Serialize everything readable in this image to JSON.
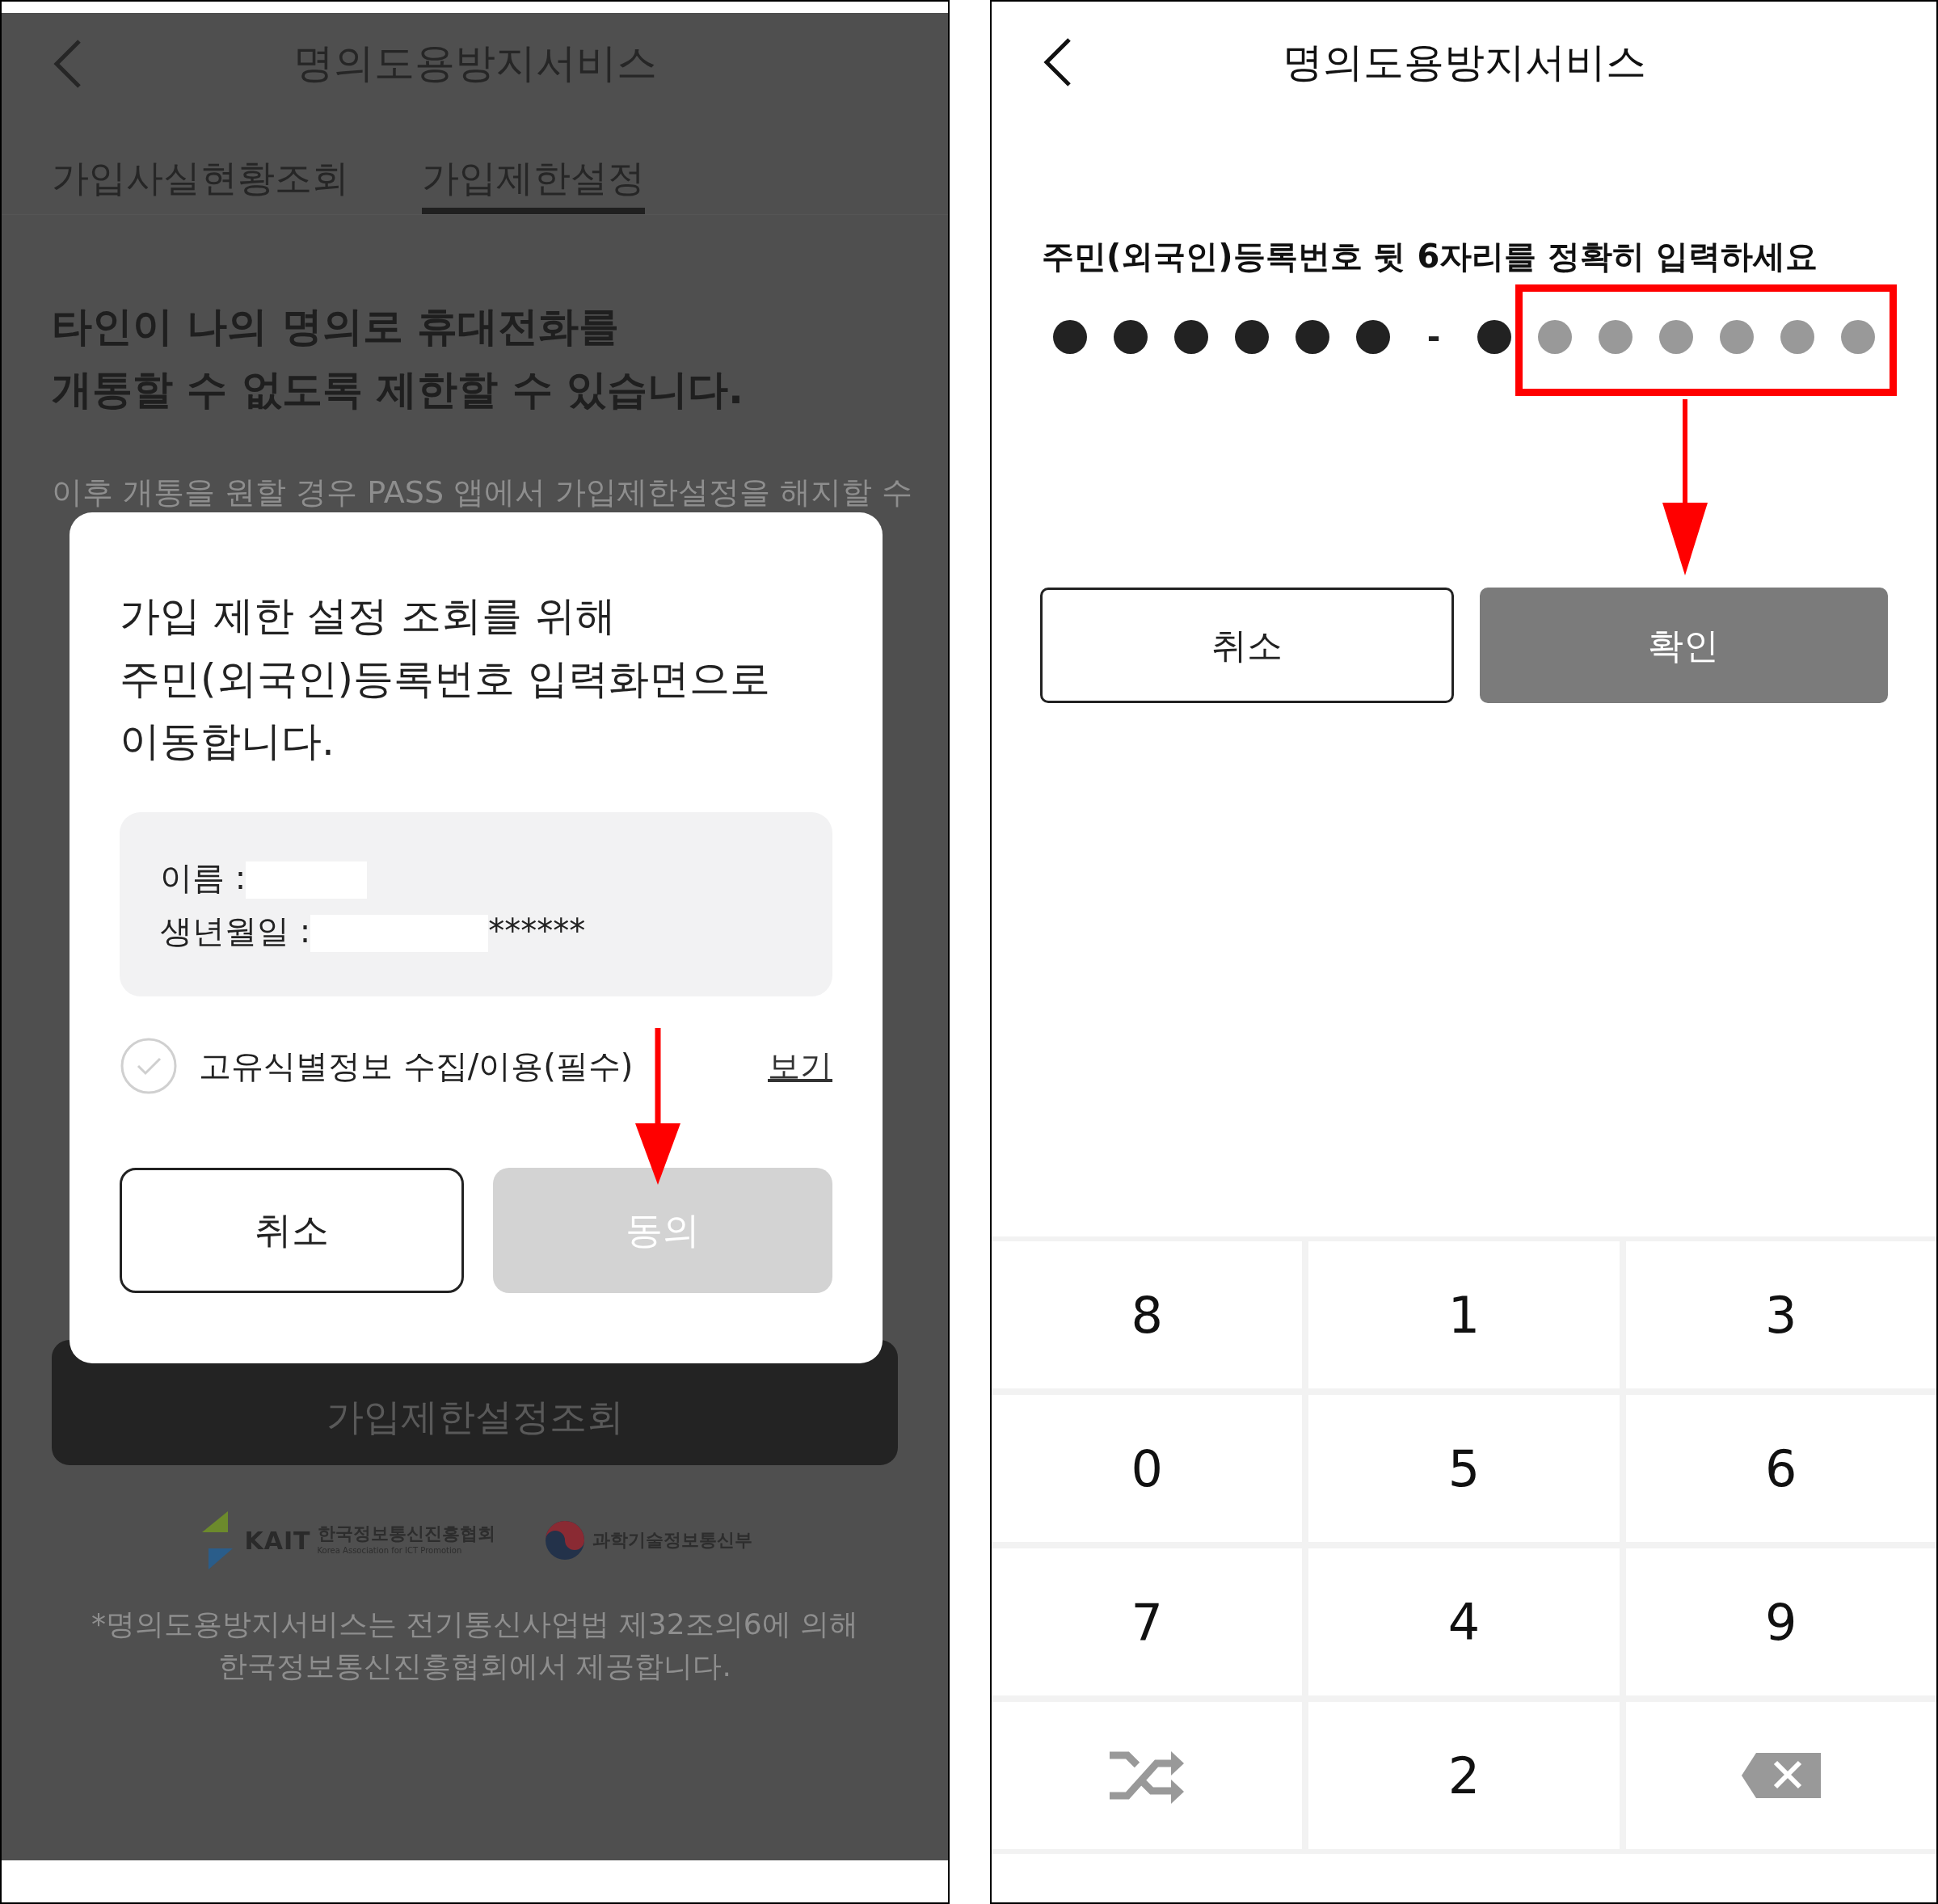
{
  "left_screen": {
    "header": {
      "title": "명의도용방지서비스"
    },
    "tabs": [
      {
        "label": "가입사실현황조회",
        "selected": false
      },
      {
        "label": "가입제한설정",
        "selected": true
      }
    ],
    "heading": [
      "타인이 나의 명의로 휴대전화를",
      "개통할 수 없도록 제한할 수 있습니다."
    ],
    "description": "이후 개통을 원할 경우 PASS 앱에서 가입제한설정을 해지할 수",
    "main_button": "가입제한설정조회",
    "logos": [
      {
        "kind": "kait",
        "mark": "KAIT",
        "name": "한국정보통신진흥협회",
        "subtitle": "Korea Association for ICT Promotion"
      },
      {
        "kind": "ministry",
        "name": "과학기술정보통신부"
      }
    ],
    "footnote": [
      "*명의도용방지서비스는 전기통신사업법 제32조의6에 의해",
      "한국정보통신진흥협회에서 제공합니다."
    ],
    "dialog": {
      "message": [
        "가입 제한 설정 조회를 위해",
        "주민(외국인)등록번호 입력화면으로",
        "이동합니다."
      ],
      "info": [
        {
          "label": "이름 :"
        },
        {
          "label": "생년월일 :",
          "suffix": "******"
        }
      ],
      "consent": {
        "label": "고유식별정보 수집/이용(필수)",
        "checked": false,
        "link": "보기"
      },
      "buttons": [
        {
          "label": "취소",
          "kind": "outline"
        },
        {
          "label": "동의",
          "kind": "primary",
          "disabled": true
        }
      ]
    }
  },
  "right_screen": {
    "header": {
      "title": "명의도용방지서비스"
    },
    "prompt": "주민(외국인)등록번호 뒷 6자리를 정확히 입력하세요",
    "pin": {
      "front": [
        {
          "filled": true
        },
        {
          "filled": true
        },
        {
          "filled": true
        },
        {
          "filled": true
        },
        {
          "filled": true
        },
        {
          "filled": true
        }
      ],
      "separator": "-",
      "back": [
        {
          "filled": true
        },
        {
          "filled": false
        },
        {
          "filled": false
        },
        {
          "filled": false
        },
        {
          "filled": false
        },
        {
          "filled": false
        },
        {
          "filled": false
        }
      ]
    },
    "buttons": [
      {
        "label": "취소",
        "kind": "outline"
      },
      {
        "label": "확인",
        "kind": "primary",
        "disabled": false
      }
    ],
    "keypad": [
      {
        "kind": "digit",
        "label": "8"
      },
      {
        "kind": "digit",
        "label": "1"
      },
      {
        "kind": "digit",
        "label": "3"
      },
      {
        "kind": "digit",
        "label": "0"
      },
      {
        "kind": "digit",
        "label": "5"
      },
      {
        "kind": "digit",
        "label": "6"
      },
      {
        "kind": "digit",
        "label": "7"
      },
      {
        "kind": "digit",
        "label": "4"
      },
      {
        "kind": "digit",
        "label": "9"
      },
      {
        "kind": "shuffle"
      },
      {
        "kind": "digit",
        "label": "2"
      },
      {
        "kind": "backspace"
      }
    ]
  }
}
